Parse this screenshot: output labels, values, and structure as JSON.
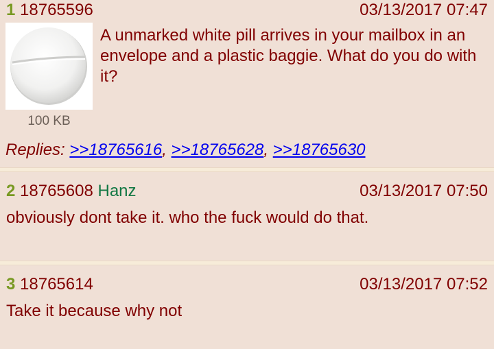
{
  "posts": [
    {
      "index": "1",
      "post_id": "18765596",
      "date": "03/13/2017 07:47",
      "body": "A unmarked white pill arrives in your mailbox in an envelope and a plastic baggie. What do you do with it?",
      "image": {
        "icon": "white-pill-image",
        "file_size": "100 KB"
      },
      "replies_label": "Replies:",
      "replies": [
        ">>18765616",
        ">>18765628",
        ">>18765630"
      ]
    },
    {
      "index": "2",
      "post_id": "18765608",
      "name": "Hanz",
      "date": "03/13/2017 07:50",
      "body": "obviously dont take it. who the fuck would do that."
    },
    {
      "index": "3",
      "post_id": "18765614",
      "date": "03/13/2017 07:52",
      "body": "Take it because why not"
    }
  ],
  "colors": {
    "background": "#f0e0d6",
    "text": "#800000",
    "index": "#789922",
    "name": "#117743",
    "link": "#0000ee",
    "separator": "#f7ecd9"
  }
}
